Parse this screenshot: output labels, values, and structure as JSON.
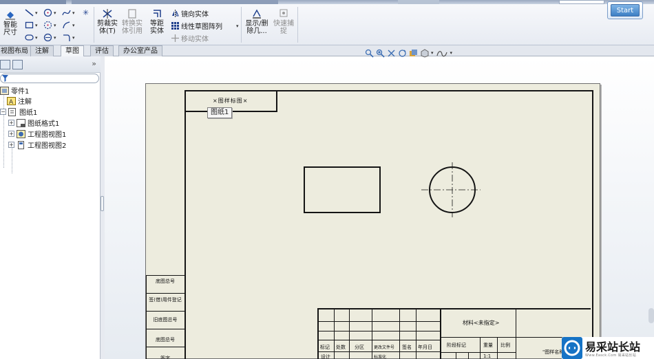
{
  "ribbon": {
    "smart_dimension": "智能尺寸",
    "trim_entities": "剪裁实体(T)",
    "convert_entities": "转换实体引用",
    "offset_entities": "等距实体",
    "mirror_entities": "镜向实体",
    "linear_pattern": "线性草图阵列",
    "move_entities": "移动实体",
    "show_delete_relations": "显示/删除几...",
    "quick_snaps": "快速捕捉",
    "start_button": "Start"
  },
  "command_tabs": [
    {
      "label": "视图布局",
      "active": false
    },
    {
      "label": "注解",
      "active": false
    },
    {
      "label": "草图",
      "active": true
    },
    {
      "label": "评估",
      "active": false
    },
    {
      "label": "办公室产品",
      "active": false
    }
  ],
  "feature_tree": {
    "root": "零件1",
    "annotations": "注解",
    "sheet": "图纸1",
    "sheet_format": "图纸格式1",
    "drawing_view_1": "工程图视图1",
    "drawing_view_2": "工程图视图2"
  },
  "drawing": {
    "tooltip": "图纸1",
    "corner_tag": "×图样标图×",
    "side_labels": [
      "底图总号",
      "签(借)用件登记",
      "旧底图总号",
      "底图总号",
      "签字"
    ],
    "title_block": {
      "material": "材料<未指定>",
      "headers": [
        "标记",
        "处数",
        "分区",
        "更改文件号",
        "签名",
        "年月日"
      ],
      "stage_mark": "阶段标记",
      "weight": "重量",
      "scale": "比例",
      "designer": "设计",
      "standardization": "标准化",
      "scale_value": "1:1",
      "drawing_name": "\"图样名称\""
    }
  },
  "watermark": {
    "title": "易采站长站",
    "subtitle": "Www.Easck.Com  易采站长站"
  },
  "colors": {
    "sheet_bg": "#edecde",
    "line": "#141414",
    "accent": "#1673c5"
  }
}
